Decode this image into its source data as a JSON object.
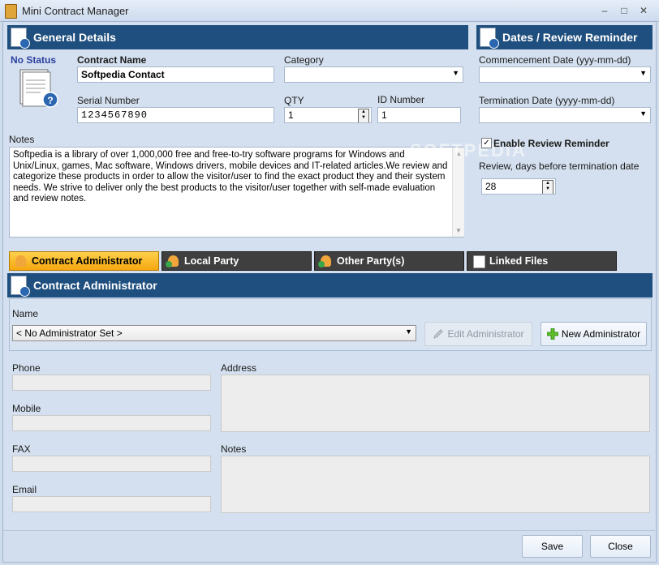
{
  "window": {
    "title": "Mini Contract Manager",
    "min": "‒",
    "max": "□",
    "close": "✕"
  },
  "general": {
    "header": "General Details",
    "status": "No Status",
    "contract_name_label": "Contract Name",
    "contract_name_value": "Softpedia Contact",
    "category_label": "Category",
    "category_value": "",
    "serial_label": "Serial Number",
    "serial_value": "1234567890",
    "qty_label": "QTY",
    "qty_value": "1",
    "id_label": "ID Number",
    "id_value": "1",
    "notes_label": "Notes",
    "notes_value": "Softpedia is a library of over 1,000,000 free and free-to-try software programs for Windows and Unix/Linux, games, Mac software, Windows drivers, mobile devices and IT-related articles.We review and categorize these products in order to allow the visitor/user to find the exact product they and their system needs. We strive to deliver only the best products to the visitor/user together with self-made evaluation and review notes."
  },
  "dates": {
    "header": "Dates / Review Reminder",
    "commencement_label": "Commencement Date (yyy-mm-dd)",
    "commencement_value": "",
    "termination_label": "Termination Date (yyyy-mm-dd)",
    "termination_value": "",
    "reminder_label": "Enable Review Reminder",
    "reminder_checked": true,
    "review_days_label": "Review, days before termination date",
    "review_days_value": "28"
  },
  "tabs": [
    {
      "label": "Contract Administrator",
      "active": true
    },
    {
      "label": "Local Party",
      "active": false
    },
    {
      "label": "Other Party(s)",
      "active": false
    },
    {
      "label": "Linked Files",
      "active": false
    }
  ],
  "admin": {
    "header": "Contract Administrator",
    "name_label": "Name",
    "name_value": "< No Administrator Set >",
    "edit_button": "Edit Administrator",
    "new_button": "New Administrator",
    "phone_label": "Phone",
    "mobile_label": "Mobile",
    "fax_label": "FAX",
    "email_label": "Email",
    "address_label": "Address",
    "notes_label": "Notes"
  },
  "footer": {
    "save": "Save",
    "close": "Close"
  },
  "watermark": "SOFTPEDIA",
  "colors": {
    "header_bg": "#1f4f7e",
    "active_tab": "#f5a70f",
    "inactive_tab": "#3f3f3f",
    "status_text": "#2a3fa0"
  }
}
